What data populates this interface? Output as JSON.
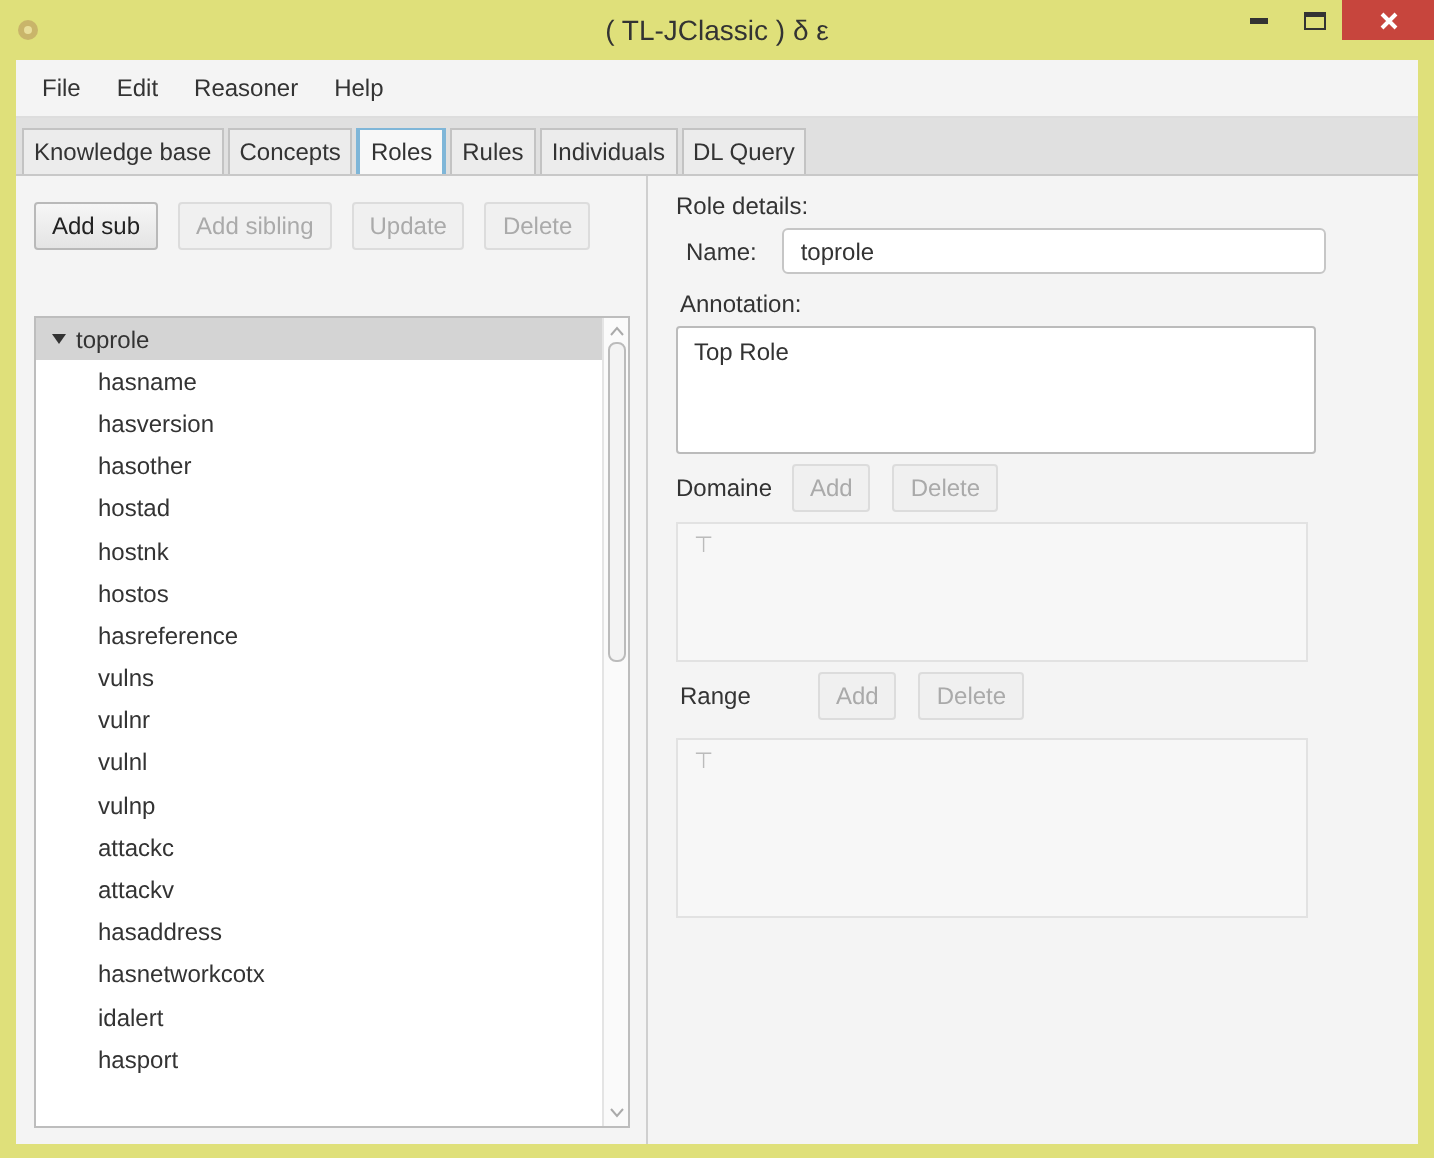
{
  "window": {
    "title": "( TL-JClassic ) δ ε"
  },
  "menu": [
    "File",
    "Edit",
    "Reasoner",
    "Help"
  ],
  "tabs": [
    {
      "label": "Knowledge base",
      "selected": false
    },
    {
      "label": "Concepts",
      "selected": false
    },
    {
      "label": "Roles",
      "selected": true
    },
    {
      "label": "Rules",
      "selected": false
    },
    {
      "label": "Individuals",
      "selected": false
    },
    {
      "label": "DL Query",
      "selected": false
    }
  ],
  "toolbar": [
    {
      "label": "Add sub",
      "disabled": false
    },
    {
      "label": "Add sibling",
      "disabled": true
    },
    {
      "label": "Update",
      "disabled": true
    },
    {
      "label": "Delete",
      "disabled": true
    }
  ],
  "tree": [
    {
      "label": "toprole",
      "expanded": true,
      "selected": true,
      "children": [
        {
          "label": "hasname",
          "selected": false
        },
        {
          "label": "hasversion",
          "selected": false
        },
        {
          "label": "hasother",
          "selected": false
        },
        {
          "label": "hostad",
          "selected": false
        },
        {
          "label": "hostnk",
          "selected": false
        },
        {
          "label": "hostos",
          "selected": false
        },
        {
          "label": "hasreference",
          "selected": false
        },
        {
          "label": "vulns",
          "selected": false
        },
        {
          "label": "vulnr",
          "selected": false
        },
        {
          "label": "vulnl",
          "selected": false
        },
        {
          "label": "vulnp",
          "selected": false
        },
        {
          "label": "attackc",
          "selected": false
        },
        {
          "label": "attackv",
          "selected": false
        },
        {
          "label": "hasaddress",
          "selected": false
        },
        {
          "label": "hasnetworkcotx",
          "selected": false
        },
        {
          "label": "idalert",
          "selected": false
        },
        {
          "label": "hasport",
          "selected": false
        }
      ]
    }
  ],
  "details": {
    "heading": "Role details:",
    "name_label": "Name:",
    "name_value": "toprole",
    "annotation_label": "Annotation:",
    "annotation_value": "Top Role"
  },
  "sections": [
    {
      "label": "Domaine",
      "buttons": [
        {
          "label": "Add",
          "disabled": true
        },
        {
          "label": "Delete",
          "disabled": true
        }
      ],
      "items": [
        "⊤"
      ]
    },
    {
      "label": "Range",
      "buttons": [
        {
          "label": "Add",
          "disabled": true
        },
        {
          "label": "Delete",
          "disabled": true
        }
      ],
      "items": [
        "⊤"
      ]
    }
  ]
}
